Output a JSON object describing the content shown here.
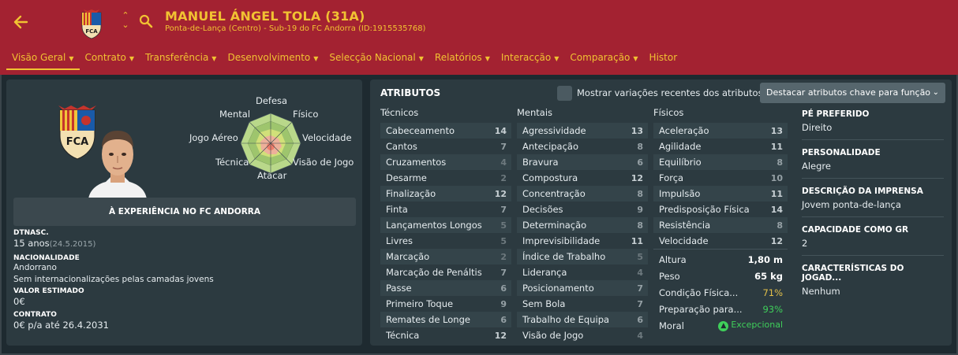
{
  "header": {
    "name": "MANUEL ÁNGEL TOLA (31A)",
    "subtitle": "Ponta-de-Lança (Centro) - Sub-19 do FC Andorra (ID:1915535768)",
    "back_icon": "back-arrow-icon",
    "crest_icon": "fc-andorra-crest",
    "search_icon": "search-icon",
    "accent": "#f1c232",
    "bg": "#a32231"
  },
  "tabs": [
    {
      "label": "Visão Geral",
      "chevron": true
    },
    {
      "label": "Contrato",
      "chevron": true
    },
    {
      "label": "Transferência",
      "chevron": true
    },
    {
      "label": "Desenvolvimento",
      "chevron": true
    },
    {
      "label": "Selecção Nacional",
      "chevron": true
    },
    {
      "label": "Relatórios",
      "chevron": true
    },
    {
      "label": "Interacção",
      "chevron": true
    },
    {
      "label": "Comparação",
      "chevron": true
    },
    {
      "label": "Histor",
      "chevron": false
    }
  ],
  "profile": {
    "radar_labels": {
      "top": "Defesa",
      "top_left": "Mental",
      "top_right": "Físico",
      "left": "Jogo Aéreo",
      "right": "Velocidade",
      "bottom_left": "Técnica",
      "bottom_right": "Visão de Jogo",
      "bottom": "Atacar"
    },
    "club_status": "À EXPERIÊNCIA NO FC ANDORRA",
    "dob_label": "DTNASC.",
    "age": "15 anos",
    "dob": "(24.5.2015)",
    "nationality_label": "NACIONALIDADE",
    "nationality": "Andorrano",
    "caps": "Sem internacionalizações pelas camadas jovens",
    "value_label": "VALOR ESTIMADO",
    "value": "0€",
    "contract_label": "CONTRATO",
    "contract": "0€ p/a até 26.4.2031"
  },
  "attributes": {
    "title": "ATRIBUTOS",
    "toggle_label": "Mostrar variações recentes dos atributos",
    "dropdown": "Destacar atributos chave para função",
    "technical_header": "Técnicos",
    "mental_header": "Mentais",
    "physical_header": "Físicos",
    "technical": [
      {
        "name": "Cabeceamento",
        "value": "14"
      },
      {
        "name": "Cantos",
        "value": "7"
      },
      {
        "name": "Cruzamentos",
        "value": "4"
      },
      {
        "name": "Desarme",
        "value": "2"
      },
      {
        "name": "Finalização",
        "value": "12"
      },
      {
        "name": "Finta",
        "value": "7"
      },
      {
        "name": "Lançamentos Longos",
        "value": "5"
      },
      {
        "name": "Livres",
        "value": "5"
      },
      {
        "name": "Marcação",
        "value": "2"
      },
      {
        "name": "Marcação de Penáltis",
        "value": "7"
      },
      {
        "name": "Passe",
        "value": "6"
      },
      {
        "name": "Primeiro Toque",
        "value": "9"
      },
      {
        "name": "Remates de Longe",
        "value": "6"
      },
      {
        "name": "Técnica",
        "value": "12"
      }
    ],
    "mental": [
      {
        "name": "Agressividade",
        "value": "13"
      },
      {
        "name": "Antecipação",
        "value": "8"
      },
      {
        "name": "Bravura",
        "value": "6"
      },
      {
        "name": "Compostura",
        "value": "12"
      },
      {
        "name": "Concentração",
        "value": "8"
      },
      {
        "name": "Decisões",
        "value": "9"
      },
      {
        "name": "Determinação",
        "value": "8"
      },
      {
        "name": "Imprevisibilidade",
        "value": "11"
      },
      {
        "name": "Índice de Trabalho",
        "value": "5"
      },
      {
        "name": "Liderança",
        "value": "4"
      },
      {
        "name": "Posicionamento",
        "value": "7"
      },
      {
        "name": "Sem Bola",
        "value": "7"
      },
      {
        "name": "Trabalho de Equipa",
        "value": "6"
      },
      {
        "name": "Visão de Jogo",
        "value": "4"
      }
    ],
    "physical": [
      {
        "name": "Aceleração",
        "value": "13"
      },
      {
        "name": "Agilidade",
        "value": "11"
      },
      {
        "name": "Equilíbrio",
        "value": "8"
      },
      {
        "name": "Força",
        "value": "10"
      },
      {
        "name": "Impulsão",
        "value": "11"
      },
      {
        "name": "Predisposição Física",
        "value": "14"
      },
      {
        "name": "Resistência",
        "value": "8"
      },
      {
        "name": "Velocidade",
        "value": "12"
      }
    ],
    "extra": {
      "height_label": "Altura",
      "height": "1,80 m",
      "weight_label": "Peso",
      "weight": "65 kg",
      "condition_label": "Condição Física...",
      "condition": "71%",
      "fitness_label": "Preparação para...",
      "fitness": "93%",
      "morale_label": "Moral",
      "morale": "Excepcional",
      "condition_color": "#e3c04a",
      "fitness_color": "#3fcf5a"
    },
    "side": {
      "foot_label": "PÉ PREFERIDO",
      "foot": "Direito",
      "personality_label": "PERSONALIDADE",
      "personality": "Alegre",
      "press_label": "DESCRIÇÃO DA IMPRENSA",
      "press": "Jovem ponta-de-lança",
      "gk_label": "CAPACIDADE COMO GR",
      "gk": "2",
      "traits_label": "CARACTERÍSTICAS DO JOGAD...",
      "traits": "Nenhum"
    }
  }
}
